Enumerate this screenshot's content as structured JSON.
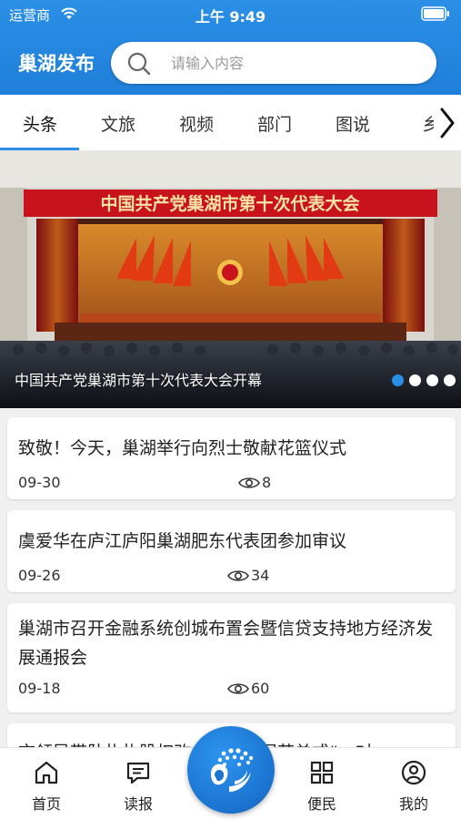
{
  "status_bar": {
    "carrier": "运营商",
    "time": "上午 9:49"
  },
  "header": {
    "app_title": "巢湖发布",
    "search_placeholder": "请输入内容"
  },
  "tabs": [
    {
      "label": "头条",
      "active": true
    },
    {
      "label": "文旅",
      "active": false
    },
    {
      "label": "视频",
      "active": false
    },
    {
      "label": "部门",
      "active": false
    },
    {
      "label": "图说",
      "active": false
    },
    {
      "label": "乡",
      "active": false
    }
  ],
  "banner": {
    "hall_banner_text": "中国共产党巢湖市第十次代表大会",
    "caption": "中国共产党巢湖市第十次代表大会开幕",
    "dots": 4,
    "active_dot": 0
  },
  "news": [
    {
      "title": "致敬！今天，巢湖举行向烈士敬献花篮仪式",
      "date": "09-30",
      "views": "8"
    },
    {
      "title": "虞爱华在庐江庐阳巢湖肥东代表团参加审议",
      "date": "09-26",
      "views": "34"
    },
    {
      "title": "巢湖市召开金融系统创城布置会暨信贷支持地方经济发展通报会",
      "date": "09-18",
      "views": "60"
    },
    {
      "title": "市领导带队扎扎股权改……业开展若单式“一对",
      "date": "",
      "views": ""
    }
  ],
  "bottom_nav": [
    {
      "label": "首页",
      "icon": "home-icon"
    },
    {
      "label": "读报",
      "icon": "newspaper-icon"
    },
    {
      "label": "",
      "icon": "center-logo-icon"
    },
    {
      "label": "便民",
      "icon": "grid-icon"
    },
    {
      "label": "我的",
      "icon": "user-icon"
    }
  ],
  "colors": {
    "primary": "#2b8fe6",
    "banner_red": "#c8121c"
  }
}
